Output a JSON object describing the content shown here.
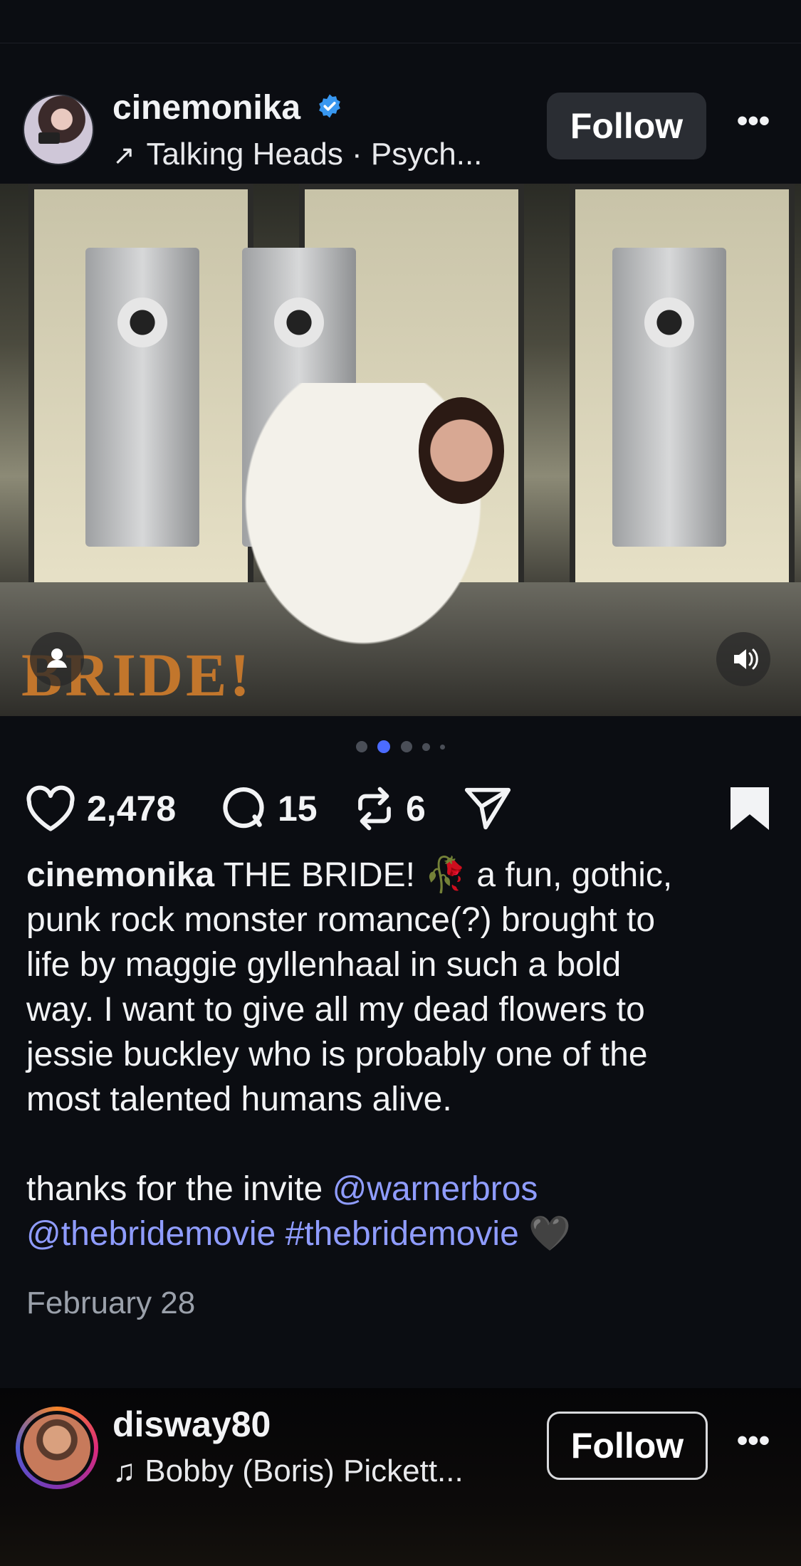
{
  "post": {
    "username": "cinemonika",
    "verified": true,
    "music": "Talking Heads · Psych...",
    "follow_label": "Follow",
    "more_label": "•••",
    "photo_text": "BRIDE!",
    "carousel": {
      "total": 5,
      "active": 2
    },
    "likes": "2,478",
    "comments": "15",
    "reposts": "6",
    "caption": {
      "user": "cinemonika",
      "lines": [
        "THE BRIDE! 🥀 a fun, gothic,",
        "punk rock monster romance(?) brought to",
        "life by maggie gyllenhaal in such a bold",
        "way. I want to give all my dead flowers to",
        "jessie buckley who is probably one of the",
        "most talented humans alive."
      ],
      "thanks_text": "thanks for the invite",
      "mention1": "@warnerbros",
      "mention2": "@thebridemovie",
      "hashtag": "#thebridemovie",
      "emoji_end": "🖤"
    },
    "date": "February 28"
  },
  "next_post": {
    "username": "disway80",
    "music": "Bobby (Boris) Pickett...",
    "follow_label": "Follow",
    "more_label": "•••"
  },
  "colors": {
    "background": "#0b0d12",
    "link": "#8f9cff",
    "verified": "#3897f0",
    "active_dot": "#4b6bff"
  }
}
